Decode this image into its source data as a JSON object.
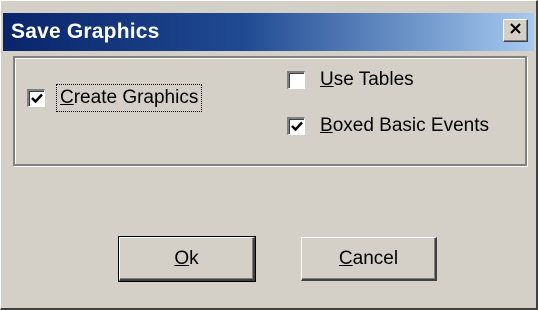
{
  "window": {
    "title": "Save Graphics"
  },
  "options": {
    "create_graphics": {
      "label_mnemonic": "C",
      "label_rest": "reate Graphics",
      "checked": true
    },
    "use_tables": {
      "label_mnemonic": "U",
      "label_rest": "se Tables",
      "checked": false
    },
    "boxed_basic_events": {
      "label_mnemonic": "B",
      "label_rest": "oxed Basic Events",
      "checked": true
    }
  },
  "buttons": {
    "ok": {
      "mnemonic": "O",
      "rest": "k"
    },
    "cancel": {
      "mnemonic": "C",
      "rest": "ancel"
    }
  },
  "icons": {
    "close": "close-icon",
    "check": "checkmark-icon"
  },
  "colors": {
    "titlebar_start": "#0a246a",
    "titlebar_end": "#a6caf0",
    "face": "#d4d0c8"
  }
}
